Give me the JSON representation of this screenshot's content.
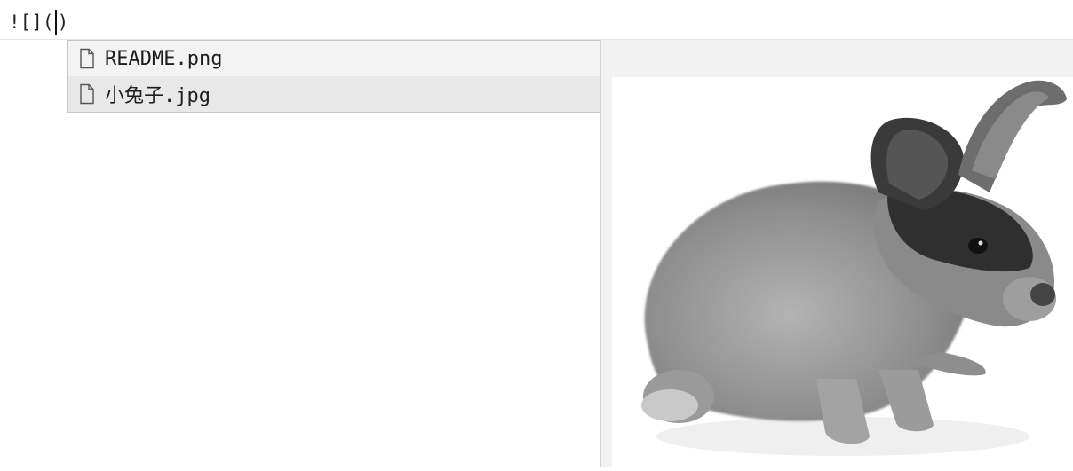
{
  "editor": {
    "line_prefix": "![](",
    "line_suffix": ")"
  },
  "autocomplete": {
    "items": [
      {
        "label": "README.png",
        "icon": "file-icon"
      },
      {
        "label": "小兔子.jpg",
        "icon": "file-icon"
      }
    ],
    "selected_index": 1
  },
  "preview": {
    "image": "rabbit-photo",
    "colors": {
      "fur": "#9c9c9c",
      "head": "#2e2e2e",
      "background": "#ffffff"
    }
  }
}
